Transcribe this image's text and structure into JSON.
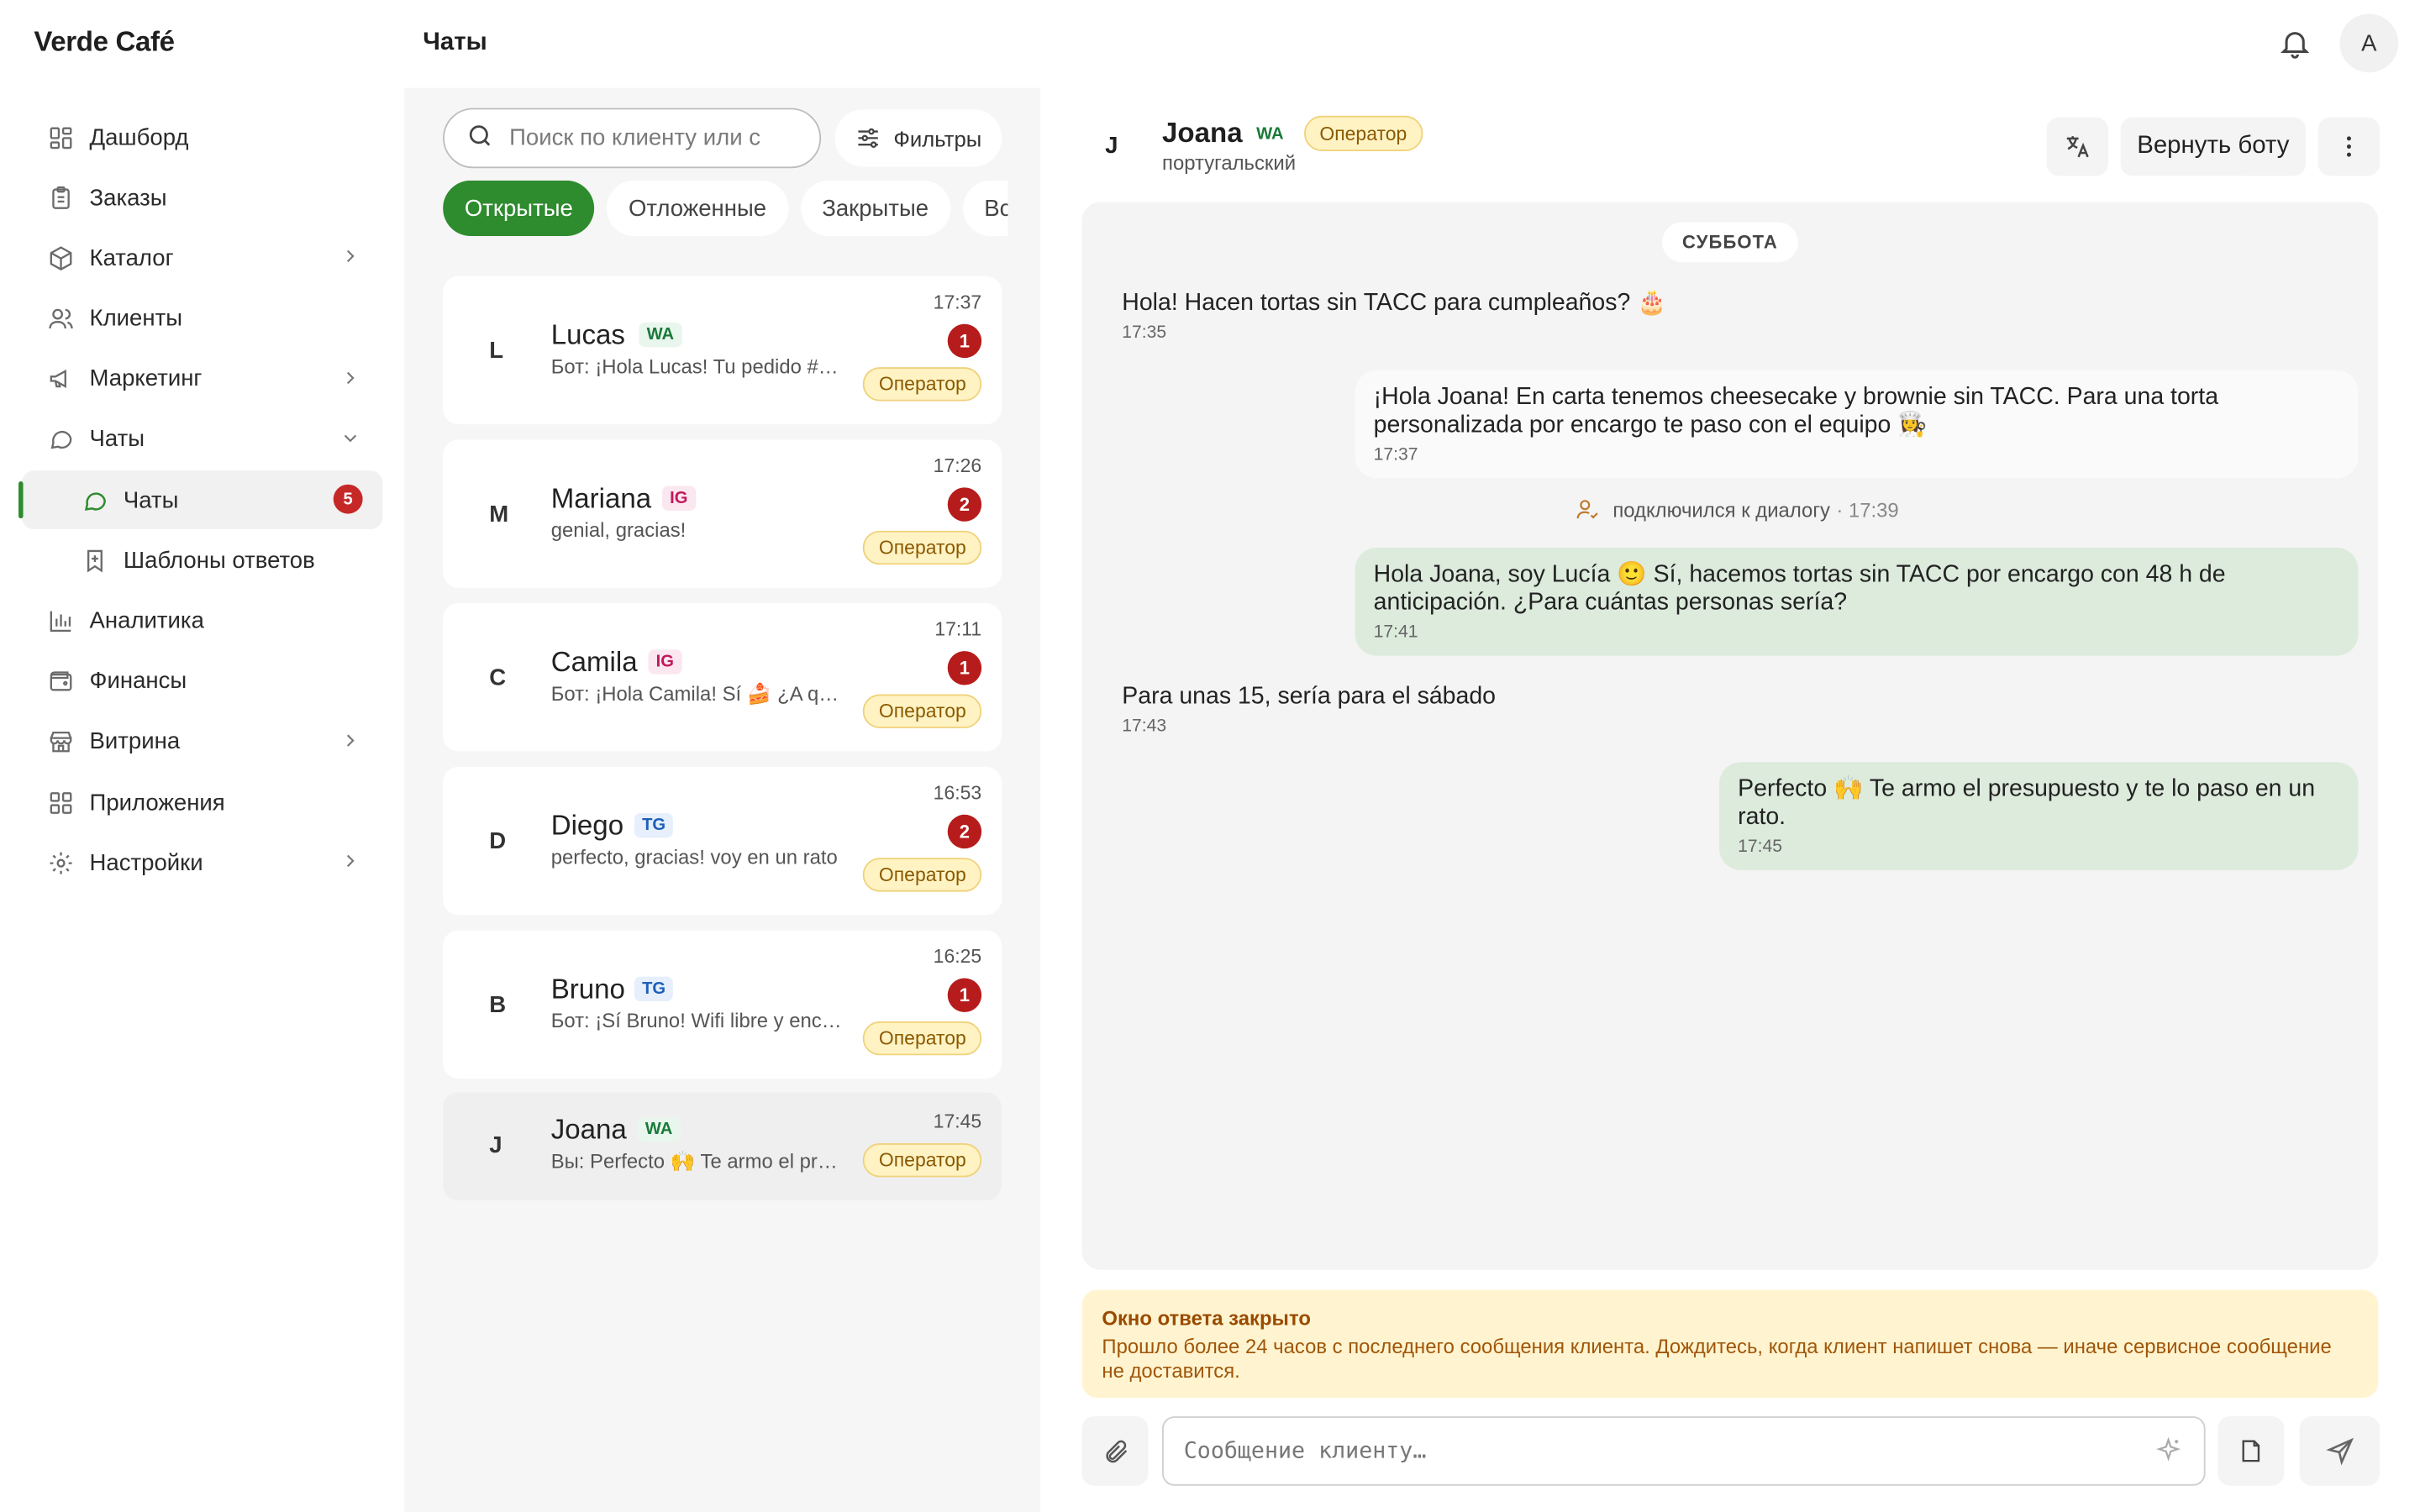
{
  "app": {
    "brand": "Verde Café",
    "page_title": "Чаты",
    "user_initial": "A"
  },
  "sidebar": {
    "items": [
      {
        "label": "Дашборд",
        "icon": "dashboard-icon"
      },
      {
        "label": "Заказы",
        "icon": "clipboard-icon"
      },
      {
        "label": "Каталог",
        "icon": "box-icon",
        "chevron": "right"
      },
      {
        "label": "Клиенты",
        "icon": "users-icon"
      },
      {
        "label": "Маркетинг",
        "icon": "megaphone-icon",
        "chevron": "right"
      },
      {
        "label": "Чаты",
        "icon": "chat-icon",
        "chevron": "down"
      },
      {
        "label": "Чаты",
        "icon": "chat-icon",
        "active": true,
        "badge": "5"
      },
      {
        "label": "Шаблоны ответов",
        "icon": "bookmark-icon"
      },
      {
        "label": "Аналитика",
        "icon": "bar-chart-icon"
      },
      {
        "label": "Финансы",
        "icon": "wallet-icon"
      },
      {
        "label": "Витрина",
        "icon": "store-icon",
        "chevron": "right"
      },
      {
        "label": "Приложения",
        "icon": "apps-icon"
      },
      {
        "label": "Настройки",
        "icon": "gear-icon",
        "chevron": "right"
      }
    ]
  },
  "list": {
    "search_placeholder": "Поиск по клиенту или с",
    "filters_label": "Фильтры",
    "tabs": [
      "Открытые",
      "Отложенные",
      "Закрытые",
      "Все"
    ],
    "conversations": [
      {
        "letter": "L",
        "name": "Lucas",
        "channel": "WA",
        "preview": "Бот: ¡Hola Lucas! Tu pedido #…",
        "time": "17:37",
        "unread": "1",
        "status": "Оператор"
      },
      {
        "letter": "M",
        "name": "Mariana",
        "channel": "IG",
        "preview": "genial, gracias!",
        "time": "17:26",
        "unread": "2",
        "status": "Оператор"
      },
      {
        "letter": "C",
        "name": "Camila",
        "channel": "IG",
        "preview": "Бот: ¡Hola Camila! Sí 🍰 ¿A qué…",
        "time": "17:11",
        "unread": "1",
        "status": "Оператор"
      },
      {
        "letter": "D",
        "name": "Diego",
        "channel": "TG",
        "preview": "perfecto, gracias! voy en un rato",
        "time": "16:53",
        "unread": "2",
        "status": "Оператор"
      },
      {
        "letter": "B",
        "name": "Bruno",
        "channel": "TG",
        "preview": "Бот: ¡Sí Bruno! Wifi libre y enc…",
        "time": "16:25",
        "unread": "1",
        "status": "Оператор"
      },
      {
        "letter": "J",
        "name": "Joana",
        "channel": "WA",
        "preview": "Вы: Perfecto 🙌 Te armo el pres…",
        "time": "17:45",
        "status": "Оператор"
      }
    ]
  },
  "chat": {
    "letter": "J",
    "name": "Joana",
    "channel": "WA",
    "status": "Оператор",
    "language": "португальский",
    "return_label": "Вернуть боту",
    "day": "СУББОТА",
    "messages": [
      {
        "text": "Hola! Hacen tortas sin TACC para cumpleaños? 🎂",
        "time": "17:35"
      },
      {
        "text": "¡Hola Joana! En carta tenemos cheesecake y brownie sin TACC. Para una torta personalizada por encargo te paso con el equipo 👩‍🍳",
        "time": "17:37"
      },
      {
        "text": "Hola Joana, soy Lucía 🙂 Sí, hacemos tortas sin TACC por encargo con 48 h de anticipación. ¿Para cuántas personas sería?",
        "time": "17:41"
      },
      {
        "text": "Para unas 15, sería para el sábado",
        "time": "17:43"
      },
      {
        "text": "Perfecto 🙌 Te armo el presupuesto y te lo paso en un rato.",
        "time": "17:45"
      }
    ],
    "system_event": {
      "text": "подключился к диалогу",
      "time": "· 17:39"
    },
    "warning": {
      "title": "Окно ответа закрыто",
      "body": "Прошло более 24 часов с последнего сообщения клиента. Дождитесь, когда клиент напишет снова — иначе сервисное сообщение не доставится."
    },
    "compose_placeholder": "Сообщение клиенту…"
  },
  "colors": {
    "accent": "#2e8b2e",
    "badge": "#c62828",
    "operator_bg": "#fff3c4",
    "operator_msg": "#dcebdc",
    "warning_bg": "#fff4cf"
  }
}
